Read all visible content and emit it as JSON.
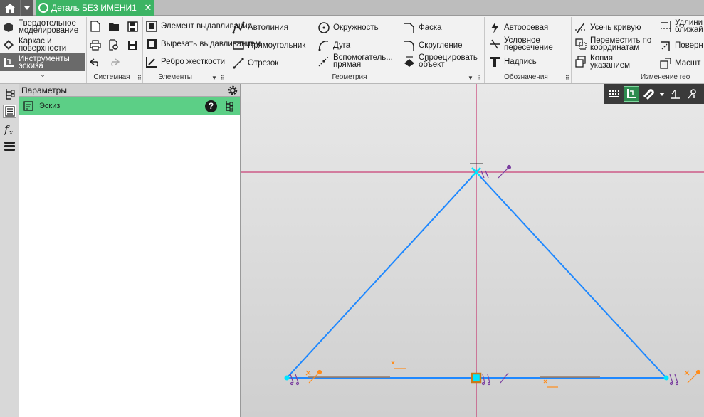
{
  "tabbar": {
    "doc_title": "Деталь БЕЗ ИМЕНИ1",
    "close": "✕"
  },
  "ribbon": {
    "modes": [
      "Твердотельное моделирование",
      "Каркас и поверхности",
      "Инструменты эскиза"
    ],
    "active_mode": 2,
    "expand": "⌄",
    "groups": {
      "system": "Системная",
      "elements": "Элементы",
      "geometry": "Геометрия",
      "designations": "Обозначения",
      "modify": "Изменение гео"
    },
    "elements_tools": [
      "Элемент выдавливания",
      "Вырезать выдавливанием",
      "Ребро жесткости"
    ],
    "geometry_tools": [
      "Автолиния",
      "Прямоугольник",
      "Отрезок",
      "Окружность",
      "Дуга",
      "Вспомогатель... прямая",
      "Фаска",
      "Скругление",
      "Спроецировать объект"
    ],
    "designation_tools": [
      "Автоосевая",
      "Условное пересечение",
      "Надпись"
    ],
    "modify_tools": [
      "Усечь кривую",
      "Переместить по координатам",
      "Копия указанием",
      "Удлини ближай",
      "Поверн",
      "Масшт"
    ]
  },
  "params": {
    "title": "Параметры",
    "sketch_label": "Эскиз",
    "help": "?"
  },
  "colors": {
    "accent_green": "#3cb464",
    "sketch_row": "#5ccf86",
    "sketch_line": "#1e88ff",
    "axis_line": "#c2185b",
    "point": "#00e5ff"
  }
}
